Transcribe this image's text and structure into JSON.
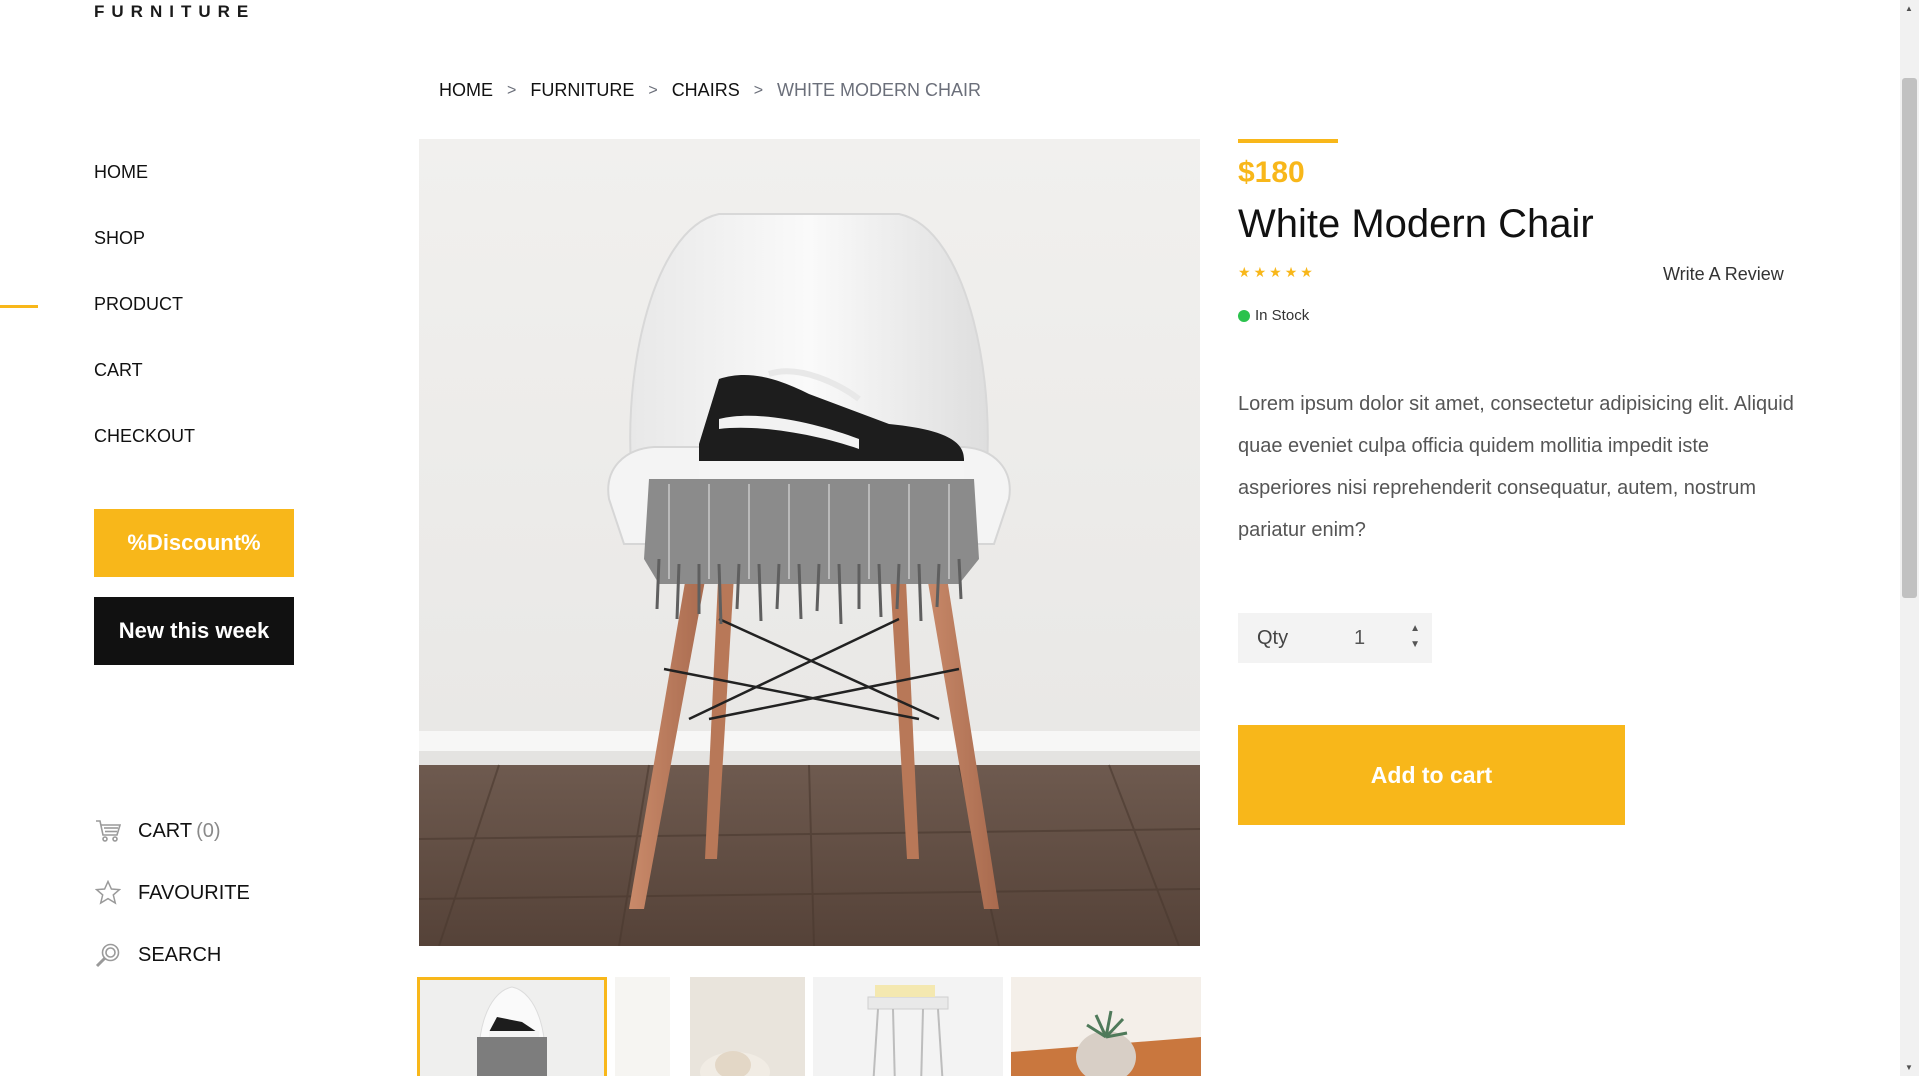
{
  "brand": {
    "logo": "FURNITURE"
  },
  "nav": {
    "items": [
      {
        "label": "HOME"
      },
      {
        "label": "SHOP"
      },
      {
        "label": "PRODUCT"
      },
      {
        "label": "CART"
      },
      {
        "label": "CHECKOUT"
      }
    ],
    "active": "PRODUCT"
  },
  "promo": {
    "discount_label": "%Discount%",
    "new_label": "New this week"
  },
  "side_links": {
    "cart": {
      "label": "CART",
      "count": "(0)",
      "icon": "cart-icon"
    },
    "favourite": {
      "label": "FAVOURITE",
      "icon": "star-outline-icon"
    },
    "search": {
      "label": "SEARCH",
      "icon": "search-icon"
    }
  },
  "breadcrumb": {
    "items": [
      "HOME",
      "FURNITURE",
      "CHAIRS",
      "WHITE MODERN CHAIR"
    ],
    "separator": ">"
  },
  "product": {
    "price": "$180",
    "title": "White Modern Chair",
    "rating": 5,
    "rating_max": 5,
    "review_link": "Write A Review",
    "stock": "In Stock",
    "description": "Lorem ipsum dolor sit amet, consectetur adipisicing elit. Aliquid quae eveniet culpa officia quidem mollitia impedit iste asperiores nisi reprehenderit consequatur, autem, nostrum pariatur enim?",
    "qty_label": "Qty",
    "qty_value": "1",
    "add_to_cart": "Add to cart"
  },
  "colors": {
    "accent": "#f8b71a",
    "dark": "#111111",
    "stock_green": "#2bc24d"
  }
}
